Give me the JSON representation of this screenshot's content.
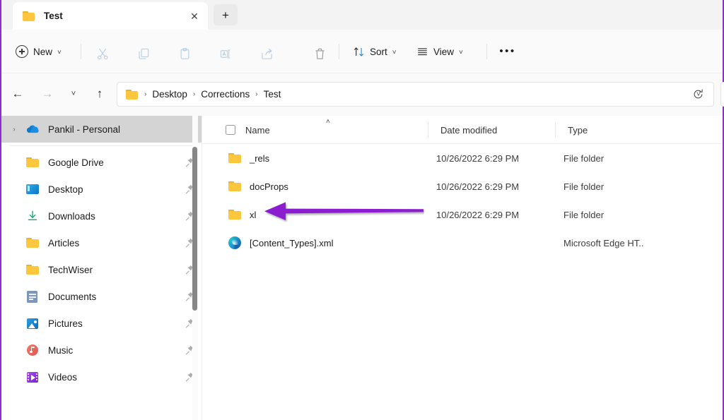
{
  "window": {
    "tab": {
      "title": "Test",
      "folder_icon": "folder-icon",
      "close_icon": "close-icon",
      "close_glyph": "✕"
    },
    "new_tab": {
      "label": "+",
      "name": "new-tab-button"
    }
  },
  "toolbar": {
    "new_label": "New",
    "new_chevron": "˅",
    "items": [
      {
        "name": "cut",
        "icon": "cut-icon",
        "enabled": false
      },
      {
        "name": "copy",
        "icon": "copy-icon",
        "enabled": false
      },
      {
        "name": "paste",
        "icon": "paste-icon",
        "enabled": false
      },
      {
        "name": "rename",
        "icon": "rename-icon",
        "enabled": false
      },
      {
        "name": "share",
        "icon": "share-icon",
        "enabled": false
      },
      {
        "name": "delete",
        "icon": "trash-icon",
        "enabled": false
      }
    ],
    "sort_label": "Sort",
    "sort_chevron": "˅",
    "view_label": "View",
    "view_chevron": "˅",
    "more_label": "•••"
  },
  "navigation": {
    "back_glyph": "←",
    "forward_glyph": "→",
    "recent_glyph": "˅",
    "up_glyph": "↑",
    "address_chevron": "˅",
    "breadcrumbs": [
      "Desktop",
      "Corrections",
      "Test"
    ],
    "crumb_separator": "›",
    "refresh_icon": "refresh-icon"
  },
  "sidebar": {
    "account": {
      "label": "Pankil - Personal",
      "icon": "onedrive-cloud-icon",
      "expander": "›",
      "highlighted": true
    },
    "items": [
      {
        "label": "Google Drive",
        "icon": "folder-icon",
        "pinned": true
      },
      {
        "label": "Desktop",
        "icon": "desktop-icon",
        "pinned": true
      },
      {
        "label": "Downloads",
        "icon": "download-icon",
        "pinned": true
      },
      {
        "label": "Articles",
        "icon": "folder-icon",
        "pinned": true
      },
      {
        "label": "TechWiser",
        "icon": "folder-icon",
        "pinned": true
      },
      {
        "label": "Documents",
        "icon": "documents-icon",
        "pinned": true
      },
      {
        "label": "Pictures",
        "icon": "pictures-icon",
        "pinned": true
      },
      {
        "label": "Music",
        "icon": "music-icon",
        "pinned": true
      },
      {
        "label": "Videos",
        "icon": "videos-icon",
        "pinned": true
      }
    ]
  },
  "file_list": {
    "columns": [
      {
        "key": "name",
        "label": "Name",
        "sorted": "asc",
        "sort_glyph": "˄"
      },
      {
        "key": "date",
        "label": "Date modified"
      },
      {
        "key": "type",
        "label": "Type"
      }
    ],
    "rows": [
      {
        "name": "_rels",
        "icon": "folder-icon",
        "date": "10/26/2022 6:29 PM",
        "type": "File folder"
      },
      {
        "name": "docProps",
        "icon": "folder-icon",
        "date": "10/26/2022 6:29 PM",
        "type": "File folder"
      },
      {
        "name": "xl",
        "icon": "folder-icon",
        "date": "10/26/2022 6:29 PM",
        "type": "File folder"
      },
      {
        "name": "[Content_Types].xml",
        "icon": "edge-icon",
        "date": "",
        "type": "Microsoft Edge HT.."
      }
    ]
  },
  "annotation": {
    "arrow_color": "#8b1fd0",
    "points_to": "xl"
  },
  "colors": {
    "accent_purple": "#8b2fc9",
    "folder_yellow": "#fcc63f",
    "highlight_grey": "#d4d4d4",
    "chrome_grey": "#fafafa"
  }
}
